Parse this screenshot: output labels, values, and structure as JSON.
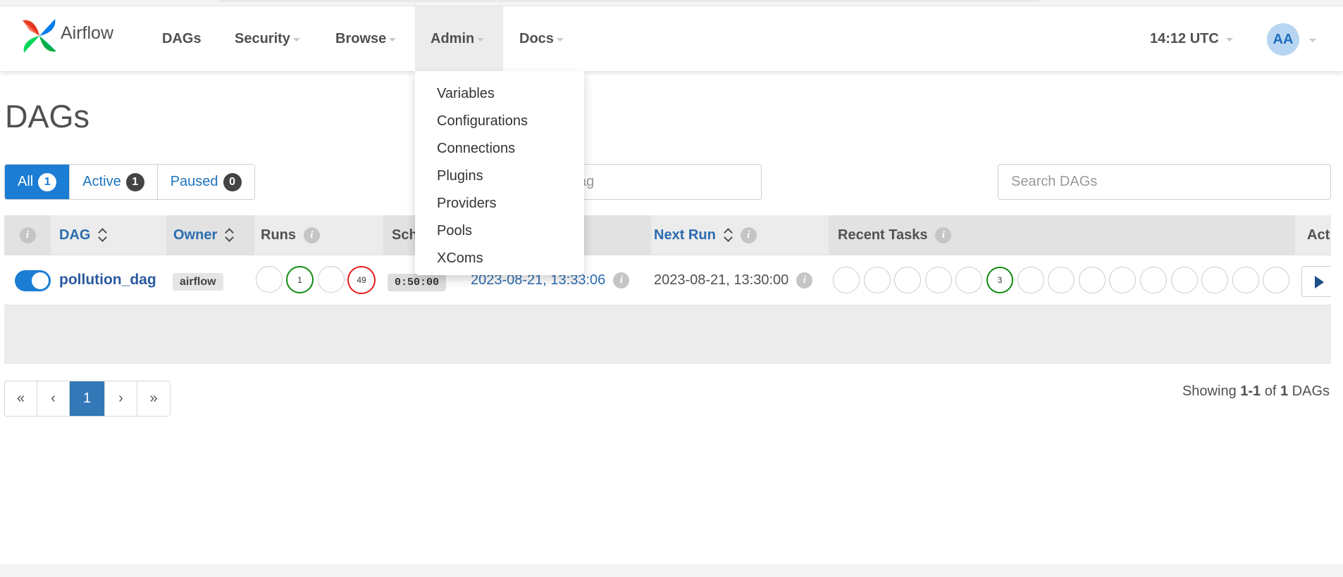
{
  "brand": {
    "name": "Airflow"
  },
  "nav": {
    "items": [
      {
        "label": "DAGs",
        "has_caret": false
      },
      {
        "label": "Security",
        "has_caret": true
      },
      {
        "label": "Browse",
        "has_caret": true
      },
      {
        "label": "Admin",
        "has_caret": true,
        "active": true
      },
      {
        "label": "Docs",
        "has_caret": true
      }
    ],
    "clock": "14:12 UTC",
    "avatar": "AA"
  },
  "admin_menu": {
    "items": [
      "Variables",
      "Configurations",
      "Connections",
      "Plugins",
      "Providers",
      "Pools",
      "XComs"
    ]
  },
  "page": {
    "title": "DAGs"
  },
  "filters": [
    {
      "label": "All",
      "count": "1",
      "active": true
    },
    {
      "label": "Active",
      "count": "1",
      "active": false
    },
    {
      "label": "Paused",
      "count": "0",
      "active": false
    }
  ],
  "tags_filter": {
    "visible_placeholder": "ag"
  },
  "search": {
    "placeholder": "Search DAGs"
  },
  "table": {
    "headers": {
      "dag": "DAG",
      "owner": "Owner",
      "runs": "Runs",
      "schedule": "Sch",
      "next_run": "Next Run",
      "recent_tasks": "Recent Tasks",
      "actions": "Act"
    },
    "rows": [
      {
        "dag_id": "pollution_dag",
        "owner": "airflow",
        "paused": false,
        "runs": [
          "",
          "1",
          "",
          "49"
        ],
        "runs_status": [
          "none",
          "success",
          "none",
          "failed"
        ],
        "schedule": "0:50:00",
        "last_run": "2023-08-21, 13:33:06",
        "next_run": "2023-08-21, 13:30:00",
        "recent_tasks": [
          "",
          "",
          "",
          "",
          "",
          "3",
          "",
          "",
          "",
          "",
          "",
          "",
          "",
          "",
          ""
        ],
        "recent_tasks_status": [
          "none",
          "none",
          "none",
          "none",
          "none",
          "success",
          "none",
          "none",
          "none",
          "none",
          "none",
          "none",
          "none",
          "none",
          "none"
        ]
      }
    ]
  },
  "pagination": {
    "first": "«",
    "prev": "‹",
    "current": "1",
    "next": "›",
    "last": "»"
  },
  "showing": {
    "prefix": "Showing",
    "range": "1-1",
    "of": "of",
    "total": "1",
    "suffix": "DAGs"
  },
  "colors": {
    "accent": "#1b7dd4",
    "success": "#118a11",
    "failed": "#e41b1b"
  },
  "icons": {
    "logo": "airflow-pinwheel-icon",
    "info": "info-icon",
    "sort": "sort-icon",
    "trigger": "play-icon"
  }
}
